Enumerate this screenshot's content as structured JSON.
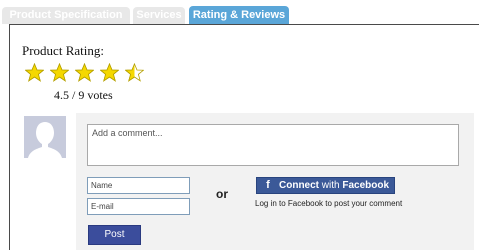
{
  "tabs": [
    {
      "label": "Product Specification",
      "active": false
    },
    {
      "label": "Services",
      "active": false
    },
    {
      "label": "Rating & Reviews",
      "active": true
    }
  ],
  "rating": {
    "title": "Product Rating:",
    "value": 4.5,
    "max": 5,
    "votes_text": "4.5 / 9 votes",
    "star_color": "#f5d800"
  },
  "comment": {
    "avatar_icon": "user-silhouette-icon",
    "placeholder": "Add a comment...",
    "name_placeholder": "Name",
    "email_placeholder": "E-mail",
    "or_text": "or",
    "post_label": "Post"
  },
  "facebook": {
    "icon": "facebook-f-icon",
    "connect_label": "Connect",
    "with_label": "with",
    "brand_label": "Facebook",
    "note": "Log in to Facebook to post your comment",
    "color": "#3b5998"
  }
}
